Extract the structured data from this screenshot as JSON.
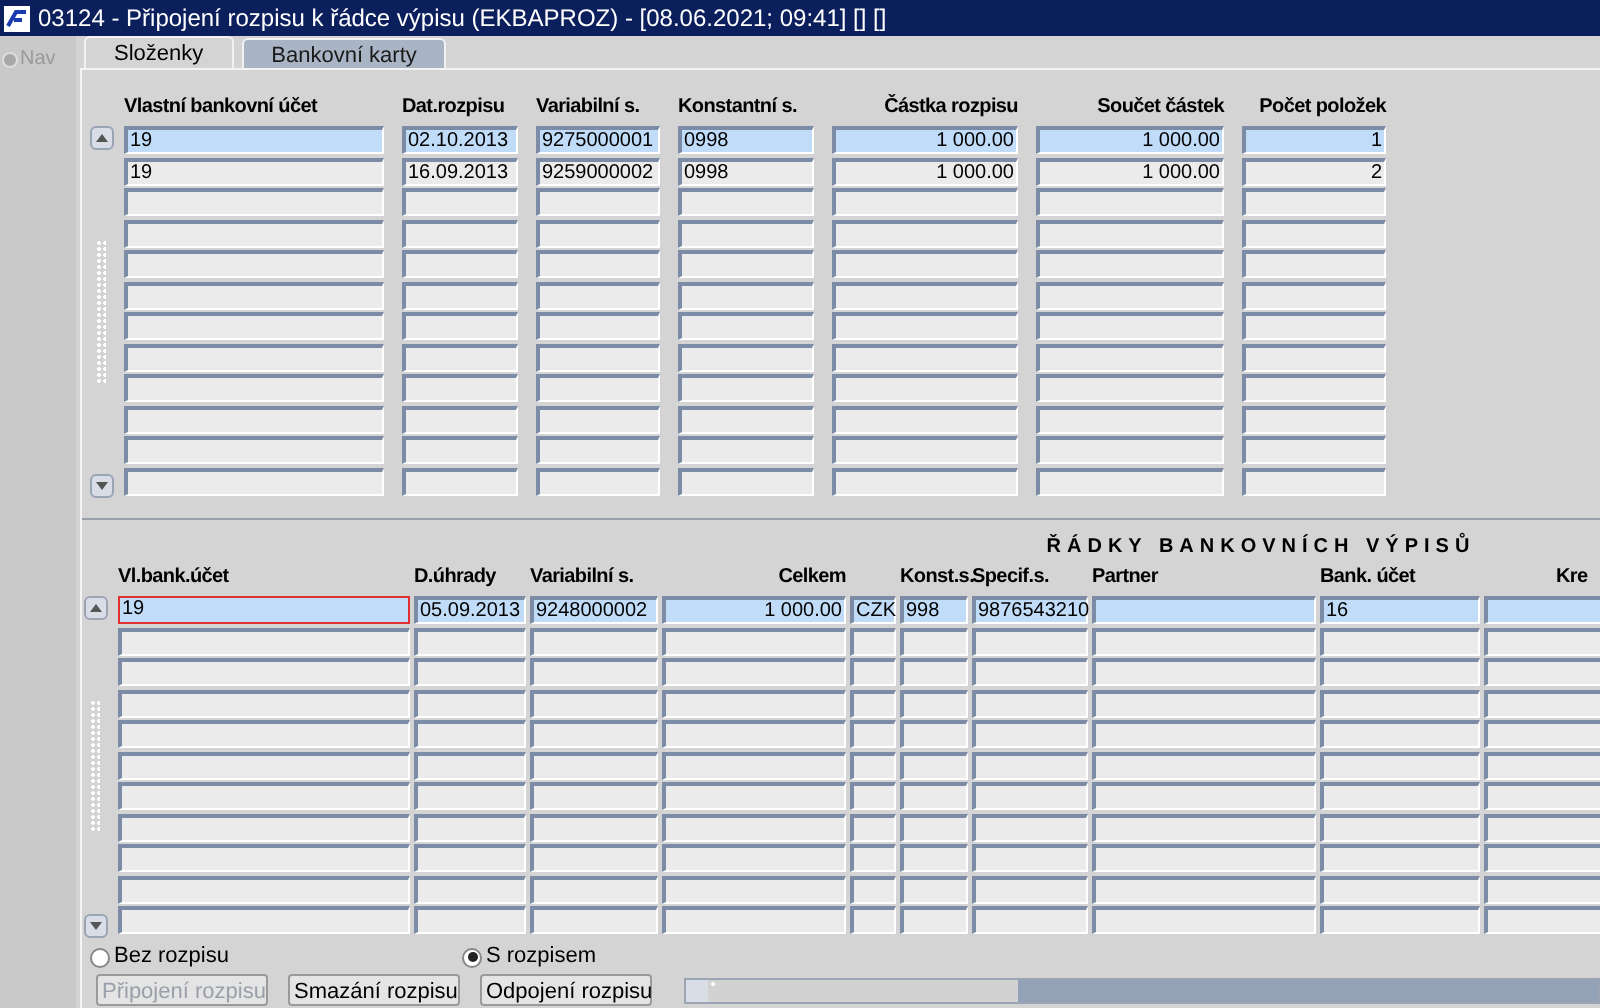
{
  "window": {
    "title": "03124 - Připojení rozpisu k řádce výpisu (EKBAPROZ) - [08.06.2021; 09:41] [] []"
  },
  "nav": {
    "label": "Nav"
  },
  "tabs": [
    {
      "label": "Složenky",
      "selected": true
    },
    {
      "label": "Bankovní karty",
      "selected": false
    }
  ],
  "top_table": {
    "columns": [
      {
        "label": "Vlastní bankovní účet",
        "kind": "text"
      },
      {
        "label": "Dat.rozpisu",
        "kind": "text"
      },
      {
        "label": "Variabilní s.",
        "kind": "text"
      },
      {
        "label": "Konstantní s.",
        "kind": "text"
      },
      {
        "label": "Částka rozpisu",
        "kind": "amount"
      },
      {
        "label": "Součet částek",
        "kind": "amount"
      },
      {
        "label": "Počet položek",
        "kind": "amount"
      }
    ],
    "rows": [
      {
        "selected": true,
        "focused": false,
        "cells": [
          "19",
          "02.10.2013",
          "9275000001",
          "0998",
          "1 000.00",
          "1 000.00",
          "1"
        ]
      },
      {
        "selected": false,
        "focused": false,
        "cells": [
          "19",
          "16.09.2013",
          "9259000002",
          "0998",
          "1 000.00",
          "1 000.00",
          "2"
        ]
      }
    ]
  },
  "bottom_table": {
    "title": "ŘÁDKY BANKOVNÍCH VÝPISŮ",
    "columns": [
      {
        "label": "Vl.bank.účet",
        "kind": "text"
      },
      {
        "label": "D.úhrady",
        "kind": "text"
      },
      {
        "label": "Variabilní s.",
        "kind": "text"
      },
      {
        "label": "Celkem",
        "kind": "amount"
      },
      {
        "kind": "text"
      },
      {
        "label": "Konst.s.",
        "kind": "text"
      },
      {
        "label": "Specif.s.",
        "kind": "text"
      },
      {
        "label": "Partner",
        "kind": "text"
      },
      {
        "label": "Bank. účet",
        "kind": "text"
      },
      {
        "label": "Kre",
        "kind": "text"
      }
    ],
    "rows": [
      {
        "selected": true,
        "focused": true,
        "cells": [
          "19",
          "05.09.2013",
          "9248000002",
          "1 000.00",
          "CZK",
          "998",
          "9876543210",
          null,
          "16",
          null
        ]
      }
    ]
  },
  "radios": [
    {
      "label": "Bez rozpisu",
      "selected": false
    },
    {
      "label": "S rozpisem",
      "selected": true
    }
  ],
  "buttons": [
    {
      "label": "Připojení rozpisu",
      "disabled": true
    },
    {
      "label": "Smazání rozpisu",
      "disabled": false
    },
    {
      "label": "Odpojení rozpisu",
      "disabled": false
    }
  ]
}
